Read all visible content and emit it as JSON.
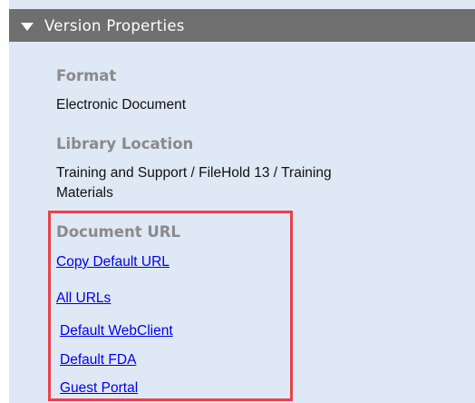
{
  "section": {
    "title": "Version Properties",
    "collapse_icon": "triangle-down-icon"
  },
  "properties": {
    "format_label": "Format",
    "format_value": "Electronic Document",
    "library_label": "Library Location",
    "library_value_line1": "Training and Support / FileHold 13 / Training",
    "library_value_line2": "Materials",
    "url_label": "Document URL"
  },
  "links": {
    "copy_default": "Copy Default URL",
    "all_urls": "All URLs",
    "default_webclient": "Default WebClient",
    "default_fda": "Default FDA",
    "guest_portal": "Guest Portal"
  },
  "colors": {
    "panel_bg": "#dfe8f5",
    "header_bg": "#6f6f6f",
    "highlight_border": "#e8434b",
    "link": "#0000ee"
  }
}
